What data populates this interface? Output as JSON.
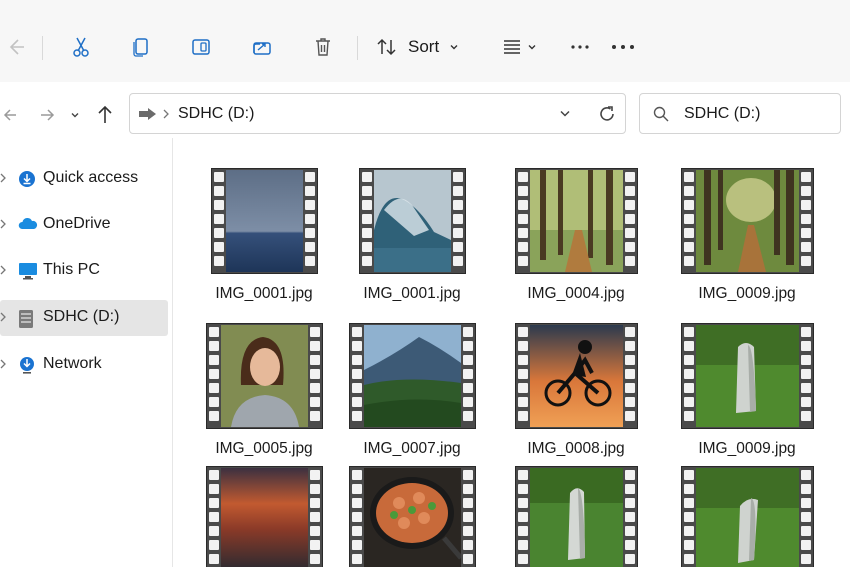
{
  "toolbar": {
    "sort_label": "Sort",
    "icons": [
      "back-arrow-icon",
      "scissors-icon",
      "copy-icon",
      "paste-icon",
      "share-icon",
      "trash-icon",
      "sort-icon",
      "chevron-down-icon",
      "view-icon",
      "chevron-down-icon",
      "more-icon",
      "more-icon"
    ]
  },
  "navigation": {
    "icons": [
      "back-icon",
      "forward-icon",
      "chevron-down-icon",
      "up-icon"
    ]
  },
  "address_bar": {
    "path": "SDHC (D:)",
    "icons": [
      "drive-arrow-icon",
      "chevron-right-icon",
      "chevron-down-icon",
      "refresh-icon"
    ]
  },
  "search": {
    "text": "SDHC (D:)"
  },
  "sidebar": {
    "items": [
      {
        "label": "Quick access",
        "icon": "quick-access-icon"
      },
      {
        "label": "OneDrive",
        "icon": "cloud-icon"
      },
      {
        "label": "This PC",
        "icon": "monitor-icon"
      },
      {
        "label": "SDHC (D:)",
        "icon": "drive-icon",
        "selected": true
      },
      {
        "label": "Network",
        "icon": "network-icon"
      }
    ]
  },
  "files": [
    {
      "name": "IMG_0001.jpg",
      "thumb": "ocean-calm"
    },
    {
      "name": "IMG_0001.jpg",
      "thumb": "wave"
    },
    {
      "name": "IMG_0004.jpg",
      "thumb": "forest"
    },
    {
      "name": "IMG_0009.jpg",
      "thumb": "forest-path"
    },
    {
      "name": "IMG_0005.jpg",
      "thumb": "woman-portrait"
    },
    {
      "name": "IMG_0007.jpg",
      "thumb": "mountain"
    },
    {
      "name": "IMG_0008.jpg",
      "thumb": "cyclist-sunset"
    },
    {
      "name": "IMG_0009.jpg",
      "thumb": "stone-pillar"
    },
    {
      "name": "",
      "thumb": "sunset-clouds"
    },
    {
      "name": "",
      "thumb": "food-pan"
    },
    {
      "name": "",
      "thumb": "stone-pillar"
    },
    {
      "name": "",
      "thumb": "stone-pillar"
    }
  ],
  "colors": {
    "accent": "#0067c0",
    "selected_bg": "#e5e5e5",
    "toolbar_bg": "#f7f7f7"
  }
}
